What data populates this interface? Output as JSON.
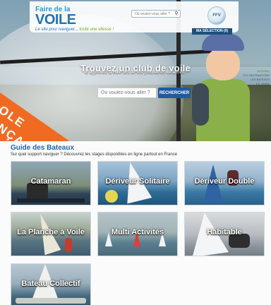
{
  "header": {
    "logo_line1": "Faire de la",
    "logo_line2": "VOILE",
    "logo_tld": ".fr",
    "tagline_part1": "Le site pour naviguer...",
    "tagline_part2": "toute une vitesse !",
    "search_placeholder": "Où voulez-vous aller ?",
    "search_icon": "magnifier-icon",
    "partner_logo_text": "FFV",
    "selection_tab": "MA SÉLECTION (0)"
  },
  "hero": {
    "title": "Trouvez un club de voile",
    "subtitle": "et apprenez la voile lors de vos prochaines vacances !",
    "banner_text": "ECOLE FRANÇAISE DE VOILE",
    "search_placeholder": "Où voulez-vous aller ?",
    "search_button": "RECHERCHER",
    "side_menu": [
      "ACCUEIL",
      "LES DESTINATIONS",
      "LES BATEAUX",
      "F.F. VOILE"
    ]
  },
  "guide": {
    "title": "Guide des Bateaux",
    "subtitle": "Sur quel support naviguer ? Découvrez les stages disponibles en ligne partout en France",
    "tiles": [
      {
        "label": "Catamaran"
      },
      {
        "label": "Dériveur Solitaire"
      },
      {
        "label": "Dériveur Double"
      },
      {
        "label": "La Planche à Voile"
      },
      {
        "label": "Multi Activités"
      },
      {
        "label": "Habitable"
      },
      {
        "label": "Bateau Collectif"
      }
    ]
  },
  "colors": {
    "brand_blue": "#1f73b5",
    "brand_green": "#7aa623",
    "banner_orange": "#f06a21",
    "button_blue": "#1f5aa2",
    "guide_title": "#2066a8"
  }
}
